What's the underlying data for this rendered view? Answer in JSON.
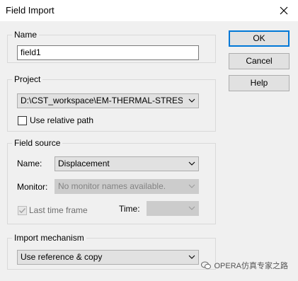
{
  "window": {
    "title": "Field Import",
    "close_icon": "close-icon"
  },
  "name_group": {
    "legend": "Name",
    "value": "field1"
  },
  "project_group": {
    "legend": "Project",
    "path_value": "D:\\CST_workspace\\EM-THERMAL-STRESS.",
    "use_relative_path_label": "Use relative path",
    "use_relative_path_checked": false
  },
  "field_source": {
    "legend": "Field source",
    "name_label": "Name:",
    "name_value": "Displacement",
    "monitor_label": "Monitor:",
    "monitor_value": "No monitor names available.",
    "last_time_frame_label": "Last time frame",
    "last_time_frame_checked": true,
    "time_label": "Time:",
    "time_value": ""
  },
  "import_mechanism": {
    "legend": "Import mechanism",
    "value": "Use reference & copy"
  },
  "buttons": {
    "ok": "OK",
    "cancel": "Cancel",
    "help": "Help"
  },
  "watermark": {
    "text": "OPERA仿真专家之路"
  }
}
